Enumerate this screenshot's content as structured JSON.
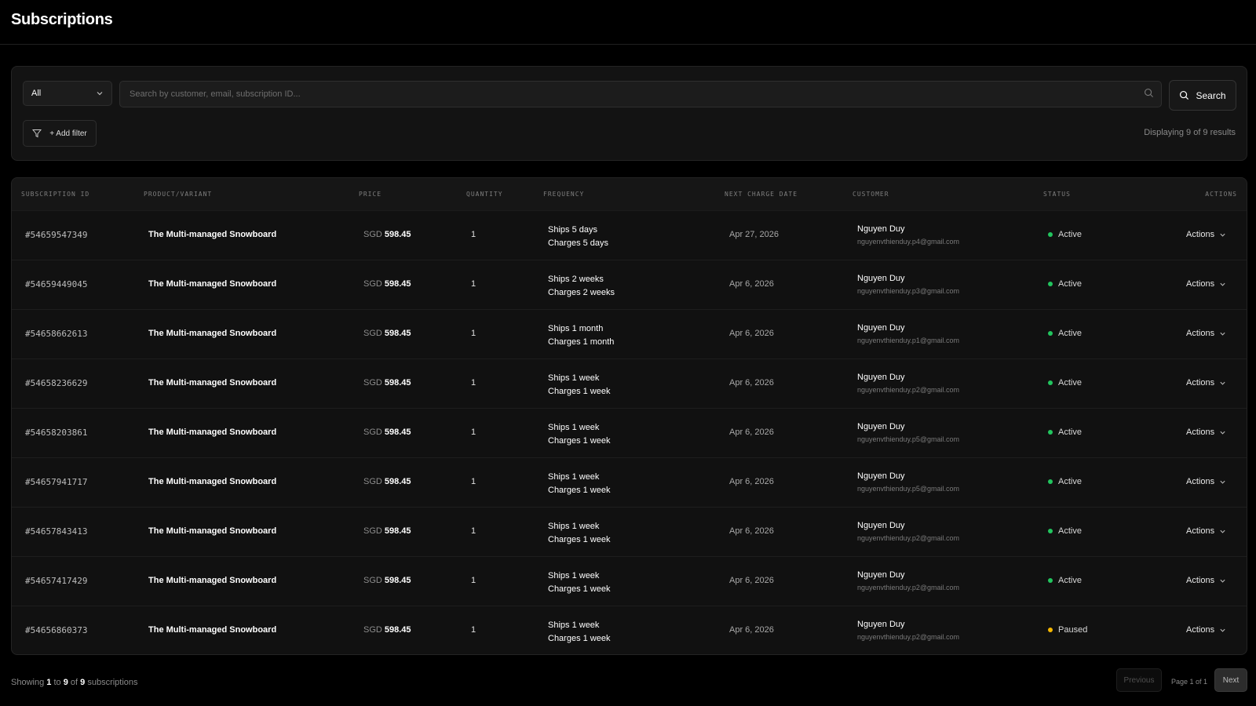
{
  "page": {
    "title": "Subscriptions"
  },
  "filters": {
    "status_select": {
      "value": "All"
    },
    "search": {
      "placeholder": "Search by customer, email, subscription ID...",
      "value": ""
    },
    "search_button_label": "Search",
    "add_filter_label": "+ Add filter",
    "result_count": "Displaying 9 of 9 results"
  },
  "table": {
    "headers": {
      "subscription_id": "SUBSCRIPTION ID",
      "product": "PRODUCT/VARIANT",
      "price": "PRICE",
      "quantity": "QUANTITY",
      "frequency": "FREQUENCY",
      "next_charge": "NEXT CHARGE DATE",
      "customer": "CUSTOMER",
      "status": "STATUS",
      "actions": "ACTIONS"
    },
    "rows": [
      {
        "id": "#54659547349",
        "product": "The Multi-managed Snowboard",
        "currency": "SGD",
        "amount": "598.45",
        "qty": "1",
        "ships": "Ships 5 days",
        "charges": "Charges 5 days",
        "next_charge": "Apr 27, 2026",
        "customer_name": "Nguyen Duy",
        "customer_email": "nguyenvthienduy.p4@gmail.com",
        "status": "Active",
        "actions_label": "Actions"
      },
      {
        "id": "#54659449045",
        "product": "The Multi-managed Snowboard",
        "currency": "SGD",
        "amount": "598.45",
        "qty": "1",
        "ships": "Ships 2 weeks",
        "charges": "Charges 2 weeks",
        "next_charge": "Apr 6, 2026",
        "customer_name": "Nguyen Duy",
        "customer_email": "nguyenvthienduy.p3@gmail.com",
        "status": "Active",
        "actions_label": "Actions"
      },
      {
        "id": "#54658662613",
        "product": "The Multi-managed Snowboard",
        "currency": "SGD",
        "amount": "598.45",
        "qty": "1",
        "ships": "Ships 1 month",
        "charges": "Charges 1 month",
        "next_charge": "Apr 6, 2026",
        "customer_name": "Nguyen Duy",
        "customer_email": "nguyenvthienduy.p1@gmail.com",
        "status": "Active",
        "actions_label": "Actions"
      },
      {
        "id": "#54658236629",
        "product": "The Multi-managed Snowboard",
        "currency": "SGD",
        "amount": "598.45",
        "qty": "1",
        "ships": "Ships 1 week",
        "charges": "Charges 1 week",
        "next_charge": "Apr 6, 2026",
        "customer_name": "Nguyen Duy",
        "customer_email": "nguyenvthienduy.p2@gmail.com",
        "status": "Active",
        "actions_label": "Actions"
      },
      {
        "id": "#54658203861",
        "product": "The Multi-managed Snowboard",
        "currency": "SGD",
        "amount": "598.45",
        "qty": "1",
        "ships": "Ships 1 week",
        "charges": "Charges 1 week",
        "next_charge": "Apr 6, 2026",
        "customer_name": "Nguyen Duy",
        "customer_email": "nguyenvthienduy.p5@gmail.com",
        "status": "Active",
        "actions_label": "Actions"
      },
      {
        "id": "#54657941717",
        "product": "The Multi-managed Snowboard",
        "currency": "SGD",
        "amount": "598.45",
        "qty": "1",
        "ships": "Ships 1 week",
        "charges": "Charges 1 week",
        "next_charge": "Apr 6, 2026",
        "customer_name": "Nguyen Duy",
        "customer_email": "nguyenvthienduy.p5@gmail.com",
        "status": "Active",
        "actions_label": "Actions"
      },
      {
        "id": "#54657843413",
        "product": "The Multi-managed Snowboard",
        "currency": "SGD",
        "amount": "598.45",
        "qty": "1",
        "ships": "Ships 1 week",
        "charges": "Charges 1 week",
        "next_charge": "Apr 6, 2026",
        "customer_name": "Nguyen Duy",
        "customer_email": "nguyenvthienduy.p2@gmail.com",
        "status": "Active",
        "actions_label": "Actions"
      },
      {
        "id": "#54657417429",
        "product": "The Multi-managed Snowboard",
        "currency": "SGD",
        "amount": "598.45",
        "qty": "1",
        "ships": "Ships 1 week",
        "charges": "Charges 1 week",
        "next_charge": "Apr 6, 2026",
        "customer_name": "Nguyen Duy",
        "customer_email": "nguyenvthienduy.p2@gmail.com",
        "status": "Active",
        "actions_label": "Actions"
      },
      {
        "id": "#54656860373",
        "product": "The Multi-managed Snowboard",
        "currency": "SGD",
        "amount": "598.45",
        "qty": "1",
        "ships": "Ships 1 week",
        "charges": "Charges 1 week",
        "next_charge": "Apr 6, 2026",
        "customer_name": "Nguyen Duy",
        "customer_email": "nguyenvthienduy.p2@gmail.com",
        "status": "Paused",
        "actions_label": "Actions"
      }
    ]
  },
  "status_colors": {
    "Active": "#22c55e",
    "Paused": "#f5b700"
  },
  "pagination": {
    "showing_prefix": "Showing",
    "from": "1",
    "to_word": "to",
    "to": "9",
    "of_word": "of",
    "total": "9",
    "suffix": "subscriptions",
    "previous_label": "Previous",
    "page_indicator": "Page 1 of 1",
    "next_label": "Next"
  },
  "icons": {
    "select_chevron": "chevron-down-icon",
    "search_input": "search-icon",
    "search_button": "search-icon",
    "add_filter": "filter-icon",
    "row_actions": "chevron-down-icon"
  }
}
